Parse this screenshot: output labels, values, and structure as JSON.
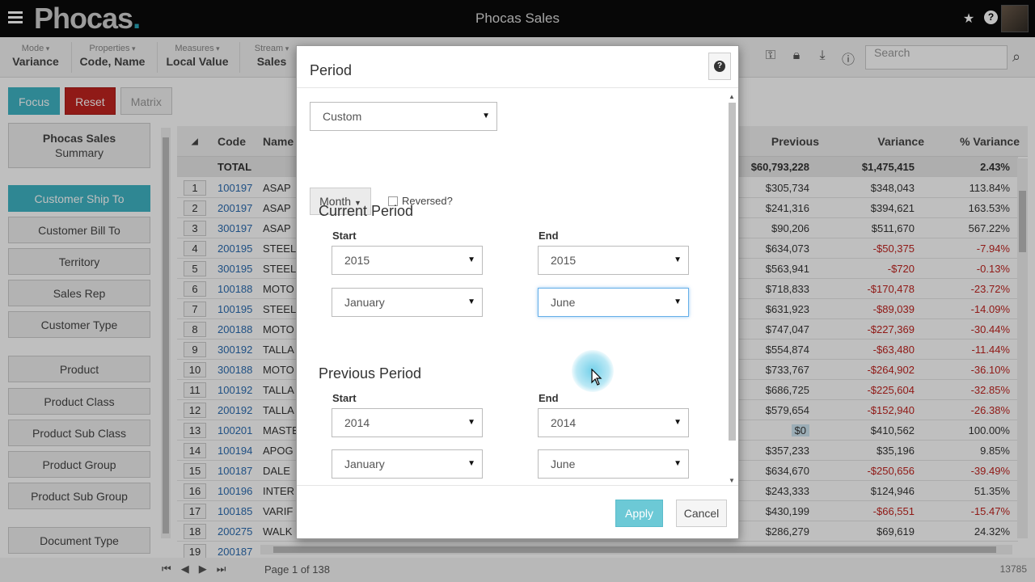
{
  "app": {
    "logo": "Phocas",
    "logo_dot": ".",
    "title": "Phocas Sales"
  },
  "toolbar": {
    "mode": {
      "label": "Mode",
      "value": "Variance"
    },
    "properties": {
      "label": "Properties",
      "value": "Code, Name"
    },
    "measures": {
      "label": "Measures",
      "value": "Local Value"
    },
    "stream": {
      "label": "Stream",
      "value": "Sales"
    },
    "search_placeholder": "Search"
  },
  "actions": {
    "focus": "Focus",
    "reset": "Reset",
    "matrix": "Matrix"
  },
  "sidebar": {
    "summary_title": "Phocas Sales",
    "summary_sub": "Summary",
    "items": [
      "Customer Ship To",
      "Customer Bill To",
      "Territory",
      "Sales Rep",
      "Customer Type",
      "Product",
      "Product Class",
      "Product Sub Class",
      "Product Group",
      "Product Sub Group",
      "Document Type"
    ]
  },
  "table": {
    "headers": {
      "code": "Code",
      "name": "Name",
      "previous": "Previous",
      "variance": "Variance",
      "pct": "% Variance"
    },
    "total": {
      "label": "TOTAL",
      "previous": "$60,793,228",
      "variance": "$1,475,415",
      "pct": "2.43%"
    },
    "rows": [
      {
        "n": "1",
        "code": "100197",
        "name": "ASAP",
        "prev": "$305,734",
        "var": "$348,043",
        "pct": "113.84%"
      },
      {
        "n": "2",
        "code": "200197",
        "name": "ASAP",
        "prev": "$241,316",
        "var": "$394,621",
        "pct": "163.53%"
      },
      {
        "n": "3",
        "code": "300197",
        "name": "ASAP",
        "prev": "$90,206",
        "var": "$511,670",
        "pct": "567.22%"
      },
      {
        "n": "4",
        "code": "200195",
        "name": "STEEL",
        "prev": "$634,073",
        "var": "-$50,375",
        "pct": "-7.94%"
      },
      {
        "n": "5",
        "code": "300195",
        "name": "STEEL",
        "prev": "$563,941",
        "var": "-$720",
        "pct": "-0.13%"
      },
      {
        "n": "6",
        "code": "100188",
        "name": "MOTO",
        "prev": "$718,833",
        "var": "-$170,478",
        "pct": "-23.72%"
      },
      {
        "n": "7",
        "code": "100195",
        "name": "STEEL",
        "prev": "$631,923",
        "var": "-$89,039",
        "pct": "-14.09%"
      },
      {
        "n": "8",
        "code": "200188",
        "name": "MOTO",
        "prev": "$747,047",
        "var": "-$227,369",
        "pct": "-30.44%"
      },
      {
        "n": "9",
        "code": "300192",
        "name": "TALLA",
        "prev": "$554,874",
        "var": "-$63,480",
        "pct": "-11.44%"
      },
      {
        "n": "10",
        "code": "300188",
        "name": "MOTO",
        "prev": "$733,767",
        "var": "-$264,902",
        "pct": "-36.10%"
      },
      {
        "n": "11",
        "code": "100192",
        "name": "TALLA",
        "prev": "$686,725",
        "var": "-$225,604",
        "pct": "-32.85%"
      },
      {
        "n": "12",
        "code": "200192",
        "name": "TALLA",
        "prev": "$579,654",
        "var": "-$152,940",
        "pct": "-26.38%"
      },
      {
        "n": "13",
        "code": "100201",
        "name": "MASTE",
        "prev": "$0",
        "var": "$410,562",
        "pct": "100.00%"
      },
      {
        "n": "14",
        "code": "100194",
        "name": "APOG",
        "prev": "$357,233",
        "var": "$35,196",
        "pct": "9.85%"
      },
      {
        "n": "15",
        "code": "100187",
        "name": "DALE",
        "prev": "$634,670",
        "var": "-$250,656",
        "pct": "-39.49%"
      },
      {
        "n": "16",
        "code": "100196",
        "name": "INTER",
        "prev": "$243,333",
        "var": "$124,946",
        "pct": "51.35%"
      },
      {
        "n": "17",
        "code": "100185",
        "name": "VARIF",
        "prev": "$430,199",
        "var": "-$66,551",
        "pct": "-15.47%"
      },
      {
        "n": "18",
        "code": "200275",
        "name": "WALK",
        "prev": "$286,279",
        "var": "$69,619",
        "pct": "24.32%"
      },
      {
        "n": "19",
        "code": "200187",
        "name": "",
        "prev": "",
        "var": "",
        "pct": ""
      }
    ]
  },
  "footer": {
    "page_info": "Page 1 of 138",
    "total_count": "13785"
  },
  "modal": {
    "title": "Period",
    "period_type": "Custom",
    "granularity": "Month",
    "reversed_label": "Reversed?",
    "current": {
      "title": "Current Period",
      "start_label": "Start",
      "end_label": "End",
      "start_year": "2015",
      "start_month": "January",
      "end_year": "2015",
      "end_month": "June"
    },
    "previous": {
      "title": "Previous Period",
      "start_label": "Start",
      "end_label": "End",
      "start_year": "2014",
      "start_month": "January",
      "end_year": "2014",
      "end_month": "June"
    },
    "apply": "Apply",
    "cancel": "Cancel"
  }
}
